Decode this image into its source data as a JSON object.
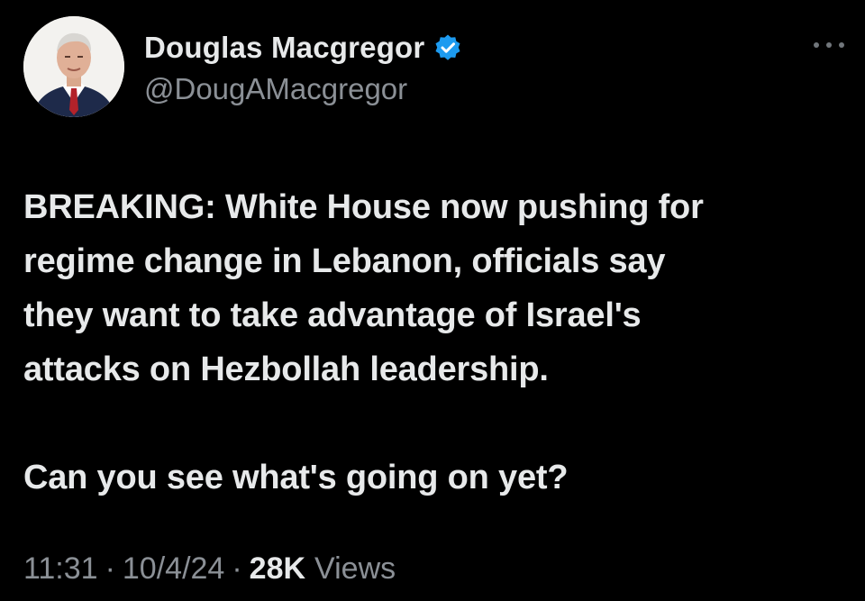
{
  "author": {
    "display_name": "Douglas Macgregor",
    "handle": "@DougAMacgregor",
    "verified": true,
    "verified_color": "#1d9bf0",
    "avatar_icon": "profile-photo"
  },
  "post": {
    "paragraphs": [
      "BREAKING: White House now pushing for\nregime change in Lebanon, officials say\nthey want to take advantage of Israel's\nattacks on Hezbollah leadership.",
      "Can you see what's going on yet?"
    ]
  },
  "meta": {
    "time": "11:31",
    "separator": "·",
    "date": "10/4/24",
    "views_count": "28K",
    "views_label": "Views"
  },
  "icons": {
    "more": "more-options-icon",
    "verified": "verified-badge-icon"
  },
  "colors": {
    "background": "#000000",
    "primary_text": "#e7e9ea",
    "secondary_text": "#8b9096"
  }
}
